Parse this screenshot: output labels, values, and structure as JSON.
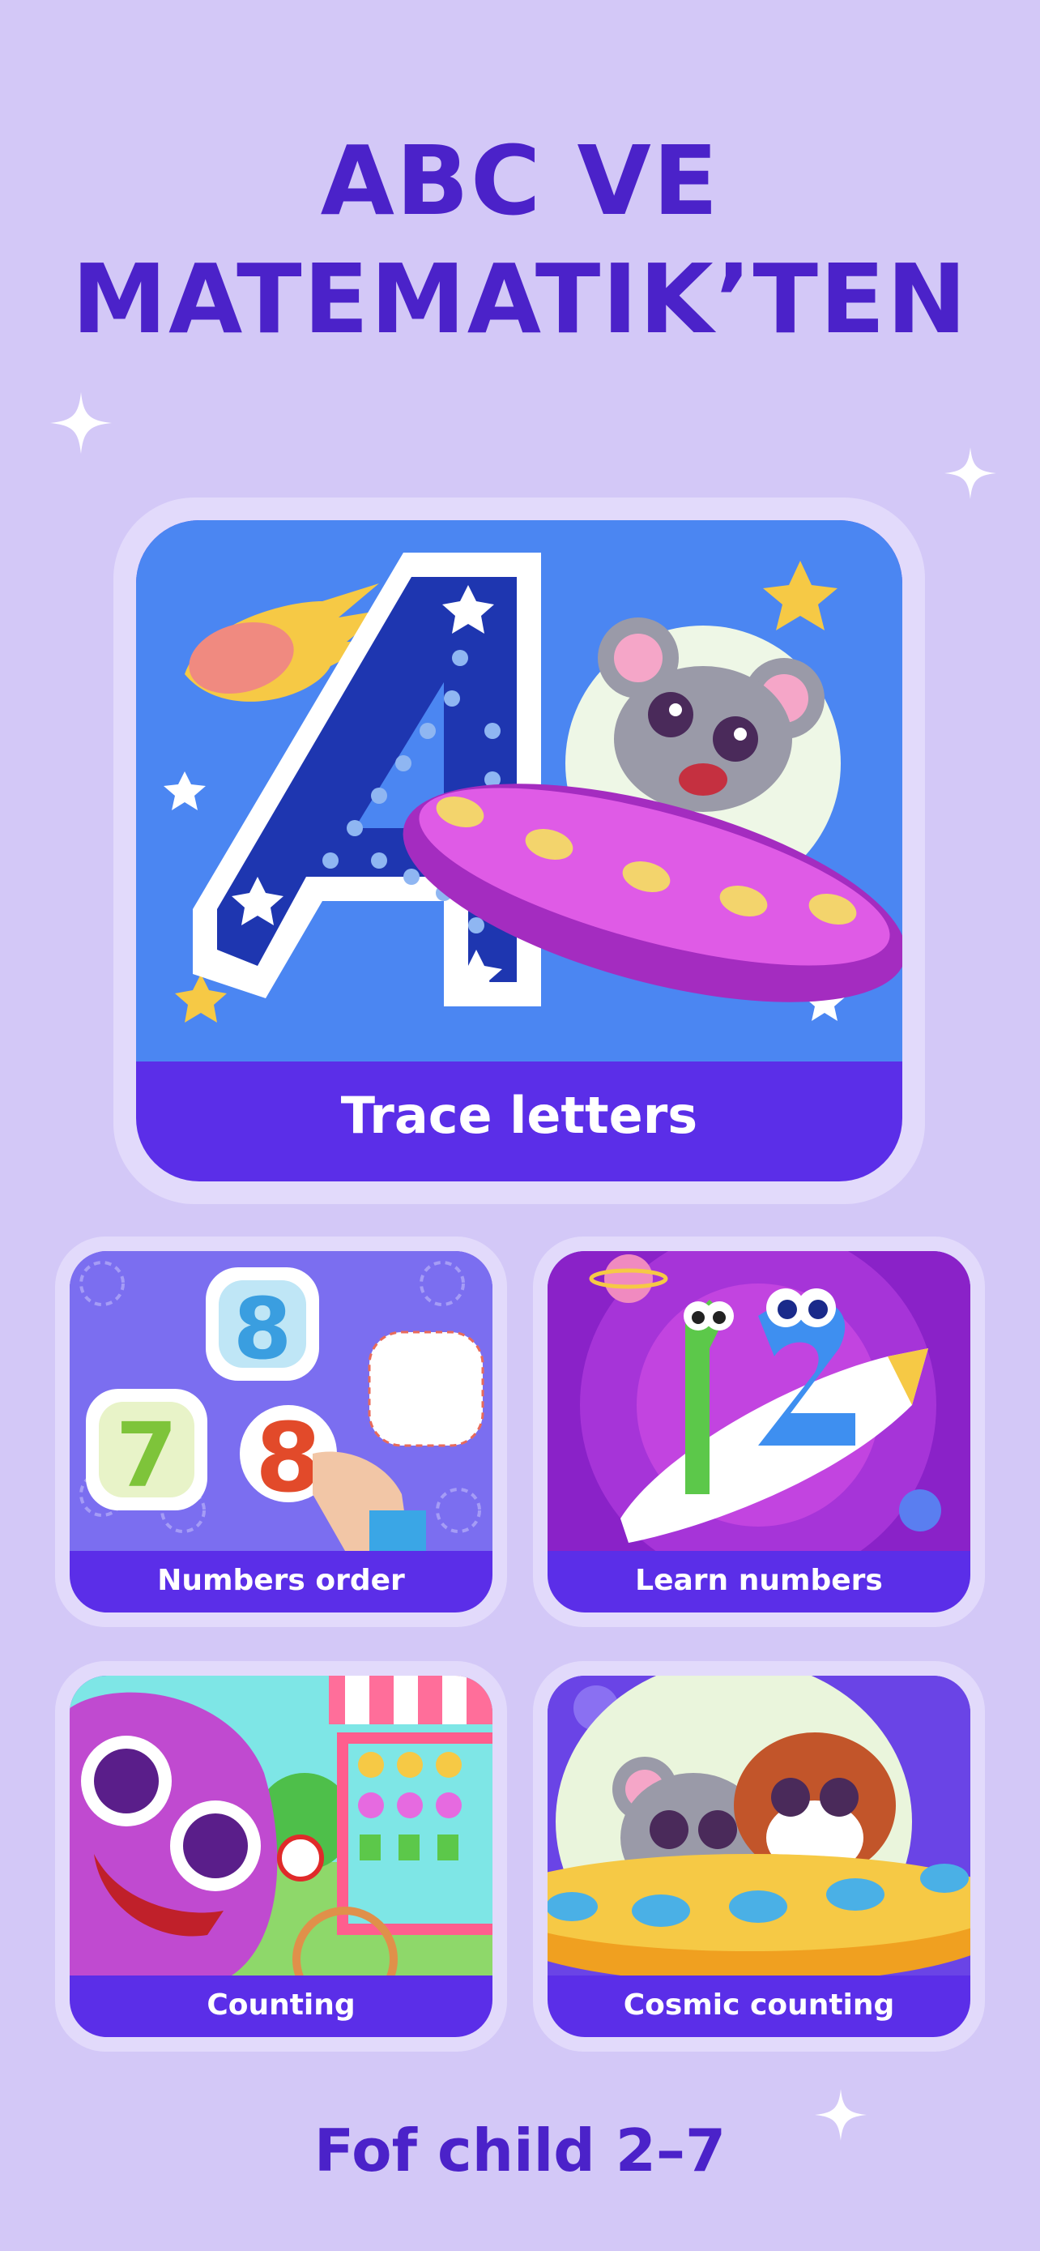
{
  "header": {
    "line1": "ABC VE",
    "line2": "MATEMATIK’TEN"
  },
  "cards": {
    "main": {
      "label": "Trace letters",
      "icon": "letter-a-ufo-mouse-art"
    },
    "numbers_order": {
      "label": "Numbers order",
      "icon": "number-puzzle-art"
    },
    "learn_numbers": {
      "label": "Learn numbers",
      "icon": "rocket-numbers-art"
    },
    "counting": {
      "label": "Counting",
      "icon": "candy-shop-monster-art"
    },
    "cosmic_counting": {
      "label": "Cosmic counting",
      "icon": "ufo-mouse-dog-art"
    }
  },
  "footer": {
    "text": "Fof child 2–7"
  },
  "colors": {
    "background": "#d3c8f7",
    "title": "#4b22c9",
    "card_label_bg": "#5b2ee8",
    "card_frame": "#e2dafb"
  }
}
